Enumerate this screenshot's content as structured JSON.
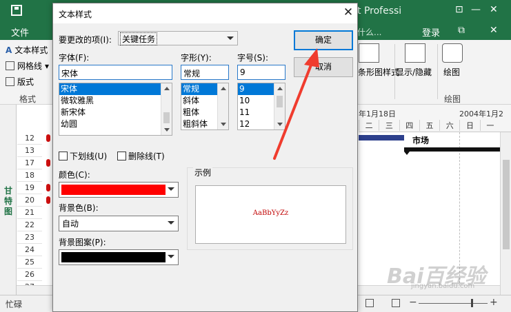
{
  "app": {
    "title_fragment": "t Professi",
    "file_tab": "文件",
    "tell_me": "什么...",
    "login": "登录",
    "ribbon_left": [
      "文本样式",
      "网格线",
      "版式"
    ],
    "ribbon_left_group": "格式",
    "ribbon_right": [
      "条形图样式",
      "显示/隐藏",
      "绘图"
    ],
    "ribbon_right_group": "绘图",
    "view_label": "甘特图",
    "rows": [
      "12",
      "13",
      "17",
      "18",
      "19",
      "20",
      "21",
      "22",
      "23",
      "24",
      "25",
      "26",
      "27"
    ],
    "row_markers": [
      "12",
      "17",
      "19",
      "20"
    ],
    "timeline_date1": "年1月18日",
    "timeline_date2": "2004年1月2",
    "timeline_days": [
      "二",
      "三",
      "四",
      "五",
      "六",
      "日",
      "一"
    ],
    "gantt_label": "市场",
    "status": "忙碌"
  },
  "dialog": {
    "title": "文本样式",
    "item_label": "要更改的项(I):",
    "item_value": "关键任务",
    "ok_label": "确定",
    "cancel_label": "取消",
    "font_label": "字体(F):",
    "font_value": "宋体",
    "font_list": [
      "宋体",
      "微软雅黑",
      "新宋体",
      "幼圆"
    ],
    "style_label": "字形(Y):",
    "style_value": "常规",
    "style_list": [
      "常规",
      "斜体",
      "粗体",
      "粗斜体"
    ],
    "size_label": "字号(S):",
    "size_value": "9",
    "size_list": [
      "9",
      "10",
      "11",
      "12"
    ],
    "underline_label": "下划线(U)",
    "strike_label": "删除线(T)",
    "color_label": "颜色(C):",
    "color_value": "#ff0000",
    "bgcolor_label": "背景色(B):",
    "bgcolor_value": "自动",
    "pattern_label": "背景图案(P):",
    "pattern_value": "#000000",
    "sample_label": "示例",
    "sample_text": "AaBbYyZz"
  },
  "colors": {
    "accent": "#217346",
    "selection": "#0078d7",
    "annotation": "#f03c2e"
  },
  "watermark": {
    "main": "Bai百经验",
    "sub": "jingyan.baidu.com"
  }
}
